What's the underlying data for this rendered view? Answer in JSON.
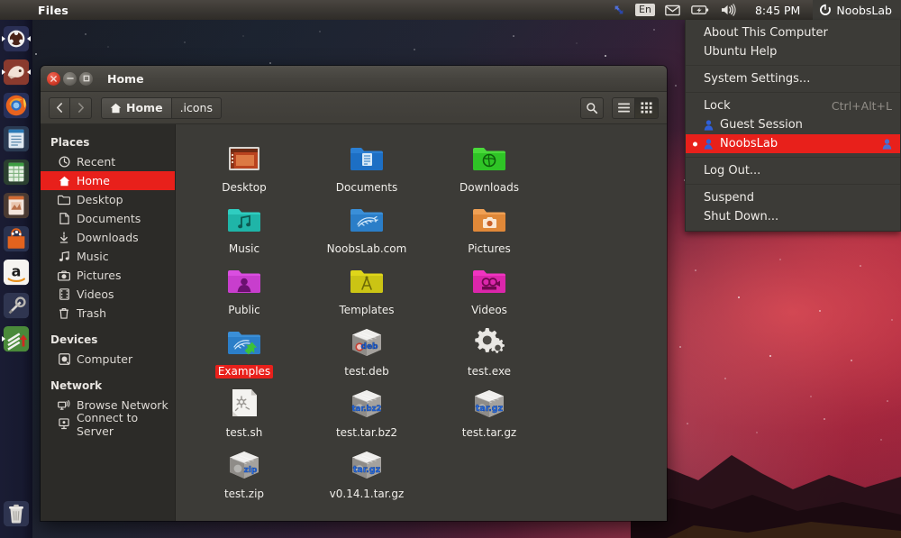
{
  "panel": {
    "app_name": "Files",
    "sync_icon": "sync-icon",
    "keyboard_layout": "En",
    "mail_icon": "envelope-icon",
    "battery_icon": "battery-icon",
    "volume_icon": "volume-icon",
    "clock": "8:45 PM",
    "session_icon": "gear-session-icon",
    "session_user": "NoobsLab"
  },
  "session_menu": {
    "items": [
      {
        "label": "About This Computer",
        "type": "item"
      },
      {
        "label": "Ubuntu Help",
        "type": "item"
      },
      {
        "type": "separator"
      },
      {
        "label": "System Settings...",
        "type": "item"
      },
      {
        "type": "separator"
      },
      {
        "label": "Lock",
        "accel": "Ctrl+Alt+L",
        "type": "item"
      },
      {
        "label": "Guest Session",
        "type": "user"
      },
      {
        "label": "NoobsLab",
        "type": "user",
        "active": true
      },
      {
        "type": "separator"
      },
      {
        "label": "Log Out...",
        "type": "item"
      },
      {
        "type": "separator"
      },
      {
        "label": "Suspend",
        "type": "item"
      },
      {
        "label": "Shut Down...",
        "type": "item"
      }
    ],
    "highlight_color": "#e8201b"
  },
  "launcher": {
    "items": [
      {
        "name": "dash-home-icon",
        "label": "Ubuntu Dash"
      },
      {
        "name": "files-nautilus-icon",
        "label": "Files"
      },
      {
        "name": "firefox-icon",
        "label": "Firefox"
      },
      {
        "name": "libreoffice-writer-icon",
        "label": "LibreOffice Writer"
      },
      {
        "name": "libreoffice-calc-icon",
        "label": "LibreOffice Calc"
      },
      {
        "name": "libreoffice-impress-icon",
        "label": "LibreOffice Impress"
      },
      {
        "name": "software-center-icon",
        "label": "Ubuntu Software Center"
      },
      {
        "name": "amazon-icon",
        "label": "Amazon"
      },
      {
        "name": "system-settings-icon",
        "label": "System Settings"
      },
      {
        "name": "software-updater-icon",
        "label": "Software Updater"
      }
    ],
    "trash": {
      "name": "trash-icon",
      "label": "Trash"
    }
  },
  "window": {
    "title": "Home",
    "controls": {
      "close": "close-button",
      "minimize": "minimize-button",
      "maximize": "maximize-button"
    },
    "toolbar": {
      "back_label": "‹",
      "forward_label": "›",
      "breadcrumbs": [
        {
          "label": "Home",
          "icon": "home-icon",
          "active": true
        },
        {
          "label": ".icons",
          "icon": null,
          "active": false
        }
      ],
      "search_icon": "search-icon",
      "list_view_icon": "list-view-icon",
      "grid_view_icon": "grid-view-icon"
    }
  },
  "sidebar": {
    "sections": [
      {
        "heading": "Places",
        "items": [
          {
            "label": "Recent",
            "icon": "clock-icon",
            "selected": false
          },
          {
            "label": "Home",
            "icon": "home-icon",
            "selected": true
          },
          {
            "label": "Desktop",
            "icon": "folder-icon",
            "selected": false
          },
          {
            "label": "Documents",
            "icon": "document-icon",
            "selected": false
          },
          {
            "label": "Downloads",
            "icon": "download-icon",
            "selected": false
          },
          {
            "label": "Music",
            "icon": "music-icon",
            "selected": false
          },
          {
            "label": "Pictures",
            "icon": "camera-icon",
            "selected": false
          },
          {
            "label": "Videos",
            "icon": "film-icon",
            "selected": false
          },
          {
            "label": "Trash",
            "icon": "trash-icon",
            "selected": false
          }
        ]
      },
      {
        "heading": "Devices",
        "items": [
          {
            "label": "Computer",
            "icon": "computer-icon",
            "selected": false
          }
        ]
      },
      {
        "heading": "Network",
        "items": [
          {
            "label": "Browse Network",
            "icon": "network-icon",
            "selected": false
          },
          {
            "label": "Connect to Server",
            "icon": "server-icon",
            "selected": false
          }
        ]
      }
    ]
  },
  "files": [
    {
      "name": "Desktop",
      "icon": "desktop-screen-icon",
      "selected": false
    },
    {
      "name": "Documents",
      "icon": "folder-documents-icon",
      "selected": false
    },
    {
      "name": "Downloads",
      "icon": "folder-downloads-icon",
      "selected": false
    },
    {
      "name": "Music",
      "icon": "folder-music-icon",
      "selected": false
    },
    {
      "name": "NoobsLab.com",
      "icon": "folder-noobslab-icon",
      "selected": false
    },
    {
      "name": "Pictures",
      "icon": "folder-pictures-icon",
      "selected": false
    },
    {
      "name": "Public",
      "icon": "folder-public-icon",
      "selected": false
    },
    {
      "name": "Templates",
      "icon": "folder-templates-icon",
      "selected": false
    },
    {
      "name": "Videos",
      "icon": "folder-videos-icon",
      "selected": false
    },
    {
      "name": "Examples",
      "icon": "folder-link-icon",
      "selected": true
    },
    {
      "name": "test.deb",
      "icon": "archive-deb-icon",
      "selected": false,
      "badge": "deb"
    },
    {
      "name": "test.exe",
      "icon": "executable-gears-icon",
      "selected": false
    },
    {
      "name": "test.sh",
      "icon": "script-file-icon",
      "selected": false
    },
    {
      "name": "test.tar.bz2",
      "icon": "archive-icon",
      "selected": false,
      "badge": "tar.bz2"
    },
    {
      "name": "test.tar.gz",
      "icon": "archive-icon",
      "selected": false,
      "badge": "tar.gz"
    },
    {
      "name": "test.zip",
      "icon": "archive-zip-icon",
      "selected": false,
      "badge": "zip"
    },
    {
      "name": "v0.14.1.tar.gz",
      "icon": "archive-icon",
      "selected": false,
      "badge": "tar.gz"
    }
  ],
  "colors": {
    "ubuntu_orange": "#dd4814",
    "highlight_red": "#e8201b",
    "panel_bg": "#3b3833",
    "window_bg": "#3c3b37",
    "sidebar_bg": "#2c2b28"
  }
}
